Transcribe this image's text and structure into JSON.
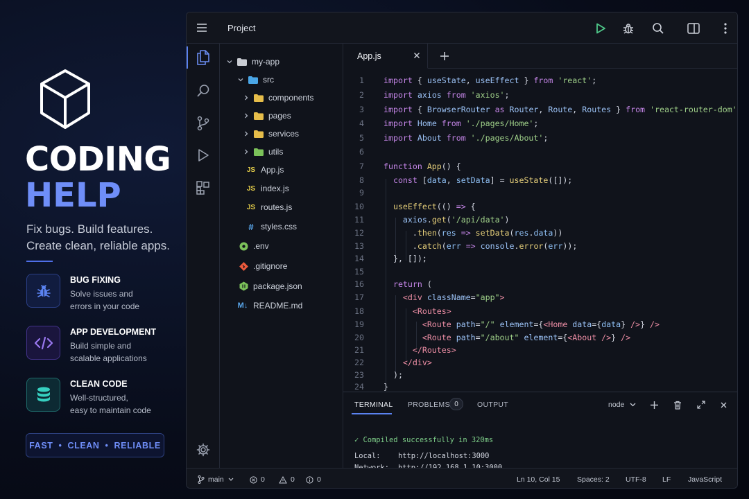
{
  "promo": {
    "title_line1": "CODING",
    "title_line2": "HELP",
    "tagline_line1": "Fix bugs. Build features.",
    "tagline_line2": "Create clean, reliable apps.",
    "features": [
      {
        "title": "BUG FIXING",
        "desc_line1": "Solve issues and",
        "desc_line2": "errors in your code",
        "icon": "bug-icon",
        "color": "#4f6fe8"
      },
      {
        "title": "APP DEVELOPMENT",
        "desc_line1": "Build simple and",
        "desc_line2": "scalable applications",
        "icon": "code-icon",
        "color": "#8a63e8"
      },
      {
        "title": "CLEAN CODE",
        "desc_line1": "Well-structured,",
        "desc_line2": "easy to maintain code",
        "icon": "database-icon",
        "color": "#2fc4b8"
      }
    ],
    "badge": [
      "FAST",
      "CLEAN",
      "RELIABLE"
    ],
    "badge_separator": "•"
  },
  "titlebar": {
    "project_label": "Project",
    "icons": [
      "menu-icon",
      "run-icon",
      "debug-icon",
      "search-icon",
      "split-editor-icon",
      "more-icon"
    ]
  },
  "activity_bar": [
    "explorer-icon",
    "search-icon",
    "source-control-icon",
    "run-debug-icon",
    "extensions-icon",
    "settings-icon"
  ],
  "explorer": {
    "root": "my-app",
    "items": [
      {
        "label": "my-app",
        "type": "folder",
        "open": true
      },
      {
        "label": "src",
        "type": "folder",
        "open": true
      },
      {
        "label": "components",
        "type": "folder",
        "open": false
      },
      {
        "label": "pages",
        "type": "folder",
        "open": false
      },
      {
        "label": "services",
        "type": "folder",
        "open": false
      },
      {
        "label": "utils",
        "type": "folder",
        "open": false
      },
      {
        "label": "App.js",
        "type": "js",
        "badge": "JS"
      },
      {
        "label": "index.js",
        "type": "js",
        "badge": "JS"
      },
      {
        "label": "routes.js",
        "type": "js",
        "badge": "JS"
      },
      {
        "label": "styles.css",
        "type": "css",
        "badge": "#"
      },
      {
        "label": ".env",
        "type": "env"
      },
      {
        "label": ".gitignore",
        "type": "git"
      },
      {
        "label": "package.json",
        "type": "json"
      },
      {
        "label": "README.md",
        "type": "md",
        "badge": "M↓"
      }
    ]
  },
  "editor": {
    "active_tab": "App.js",
    "add_tab_label": "+",
    "line_numbers": [
      "1",
      "2",
      "3",
      "4",
      "5",
      "6",
      "7",
      "8",
      "9",
      "10",
      "11",
      "12",
      "13",
      "14",
      "15",
      "16",
      "17",
      "18",
      "19",
      "20",
      "21",
      "22",
      "23",
      "24"
    ]
  },
  "panel": {
    "tabs": [
      "TERMINAL",
      "PROBLEMS",
      "OUTPUT"
    ],
    "problems_count": "0",
    "shell": "node",
    "lines": {
      "compiled": "✓ Compiled successfully in 320ms",
      "local_label": "Local:",
      "local_url": "http://localhost:3000",
      "network_label": "Network:",
      "network_url": "http://192.168.1.10:3000"
    }
  },
  "statusbar": {
    "branch": "main",
    "errors": "0",
    "warnings": "0",
    "info": "0",
    "cursor": "Ln 10, Col 15",
    "spaces": "Spaces: 2",
    "encoding": "UTF-8",
    "eol": "LF",
    "language": "JavaScript"
  }
}
